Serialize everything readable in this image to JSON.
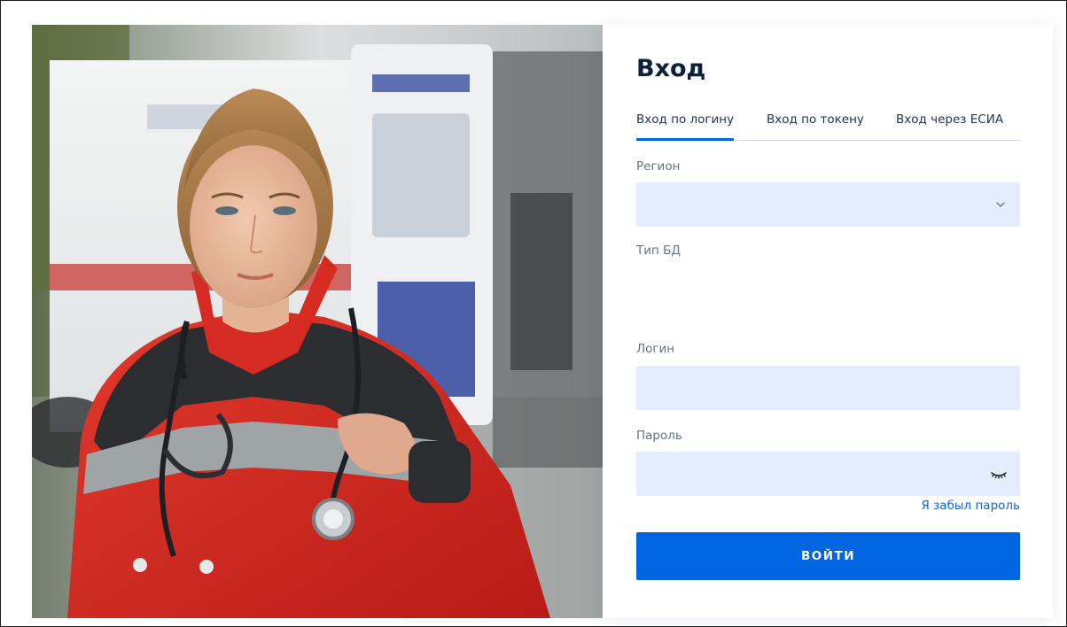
{
  "login": {
    "title": "Вход",
    "tabs": [
      {
        "label": "Вход по логину",
        "active": true
      },
      {
        "label": "Вход по токену",
        "active": false
      },
      {
        "label": "Вход через ЕСИА",
        "active": false
      }
    ],
    "region": {
      "label": "Регион",
      "value": "",
      "icon": "chevron-down-icon"
    },
    "db_type": {
      "label": "Тип БД"
    },
    "login_field": {
      "label": "Логин",
      "value": ""
    },
    "password_field": {
      "label": "Пароль",
      "value": "",
      "icon": "eye-closed-icon"
    },
    "forgot_link": "Я забыл пароль",
    "submit_label": "ВОЙТИ"
  },
  "colors": {
    "accent": "#0065e0",
    "field_bg": "#e2edfd",
    "title": "#0b1f3e",
    "label": "#6a7282",
    "link": "#1466d8",
    "uniform_red": "#d9271f",
    "uniform_dark": "#272a2f"
  },
  "hero_image": {
    "icon": "paramedic-photo"
  }
}
